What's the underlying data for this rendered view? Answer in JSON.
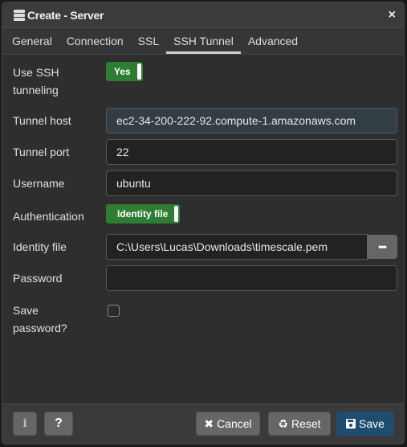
{
  "dialog": {
    "title": "Create - Server",
    "close_icon": "×"
  },
  "tabs": [
    {
      "label": "General",
      "active": false
    },
    {
      "label": "Connection",
      "active": false
    },
    {
      "label": "SSL",
      "active": false
    },
    {
      "label": "SSH Tunnel",
      "active": true
    },
    {
      "label": "Advanced",
      "active": false
    }
  ],
  "form": {
    "use_ssh": {
      "label_line1": "Use SSH",
      "label_line2": "tunneling",
      "value": "Yes"
    },
    "tunnel_host": {
      "label": "Tunnel host",
      "value": "ec2-34-200-222-92.compute-1.amazonaws.com"
    },
    "tunnel_port": {
      "label": "Tunnel port",
      "value": "22"
    },
    "username": {
      "label": "Username",
      "value": "ubuntu"
    },
    "authentication": {
      "label": "Authentication",
      "value": "Identity file"
    },
    "identity_file": {
      "label": "Identity file",
      "value": "C:\\Users\\Lucas\\Downloads\\timescale.pem",
      "browse_label": "•••"
    },
    "password": {
      "label": "Password",
      "value": ""
    },
    "save_password": {
      "label_line1": "Save",
      "label_line2": "password?",
      "checked": false
    }
  },
  "footer": {
    "info_label": "i",
    "help_label": "?",
    "cancel_icon": "✖",
    "cancel_label": "Cancel",
    "reset_icon": "♻",
    "reset_label": "Reset",
    "save_label": "Save"
  }
}
